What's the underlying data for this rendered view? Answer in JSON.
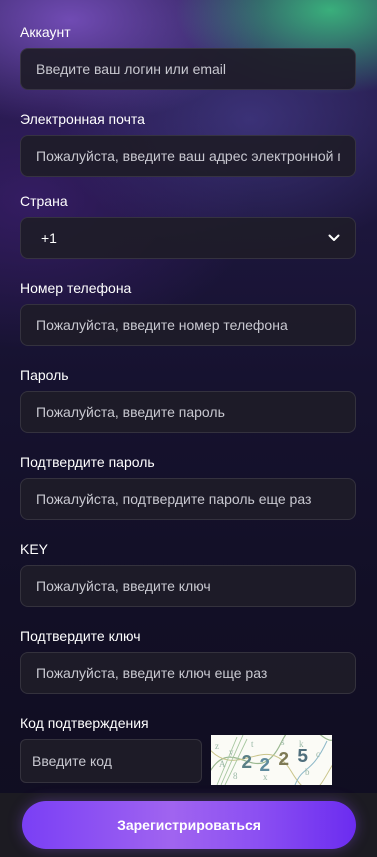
{
  "form": {
    "account": {
      "label": "Аккаунт",
      "placeholder": "Введите ваш логин или email"
    },
    "email": {
      "label": "Электронная почта",
      "placeholder": "Пожалуйста, введите ваш адрес электронной почты"
    },
    "country": {
      "label": "Страна",
      "value": "+1"
    },
    "phone": {
      "label": "Номер телефона",
      "placeholder": "Пожалуйста, введите номер телефона"
    },
    "password": {
      "label": "Пароль",
      "placeholder": "Пожалуйста, введите пароль"
    },
    "confirm_password": {
      "label": "Подтвердите пароль",
      "placeholder": "Пожалуйста, подтвердите пароль еще раз"
    },
    "key": {
      "label": "KEY",
      "placeholder": "Пожалуйста, введите ключ"
    },
    "confirm_key": {
      "label": "Подтвердите ключ",
      "placeholder": "Пожалуйста, введите ключ еще раз"
    },
    "verification": {
      "label": "Код подтверждения",
      "placeholder": "Введите код",
      "captcha_text": "2225"
    }
  },
  "submit": {
    "label": "Зарегистрироваться"
  },
  "colors": {
    "accent_start": "#7a3ff5",
    "accent_end": "#6b2cf0",
    "field_bg": "#1e1c28",
    "bottom_bar": "#1c1b22"
  },
  "icons": {
    "select_arrow": "chevron-down-icon"
  }
}
